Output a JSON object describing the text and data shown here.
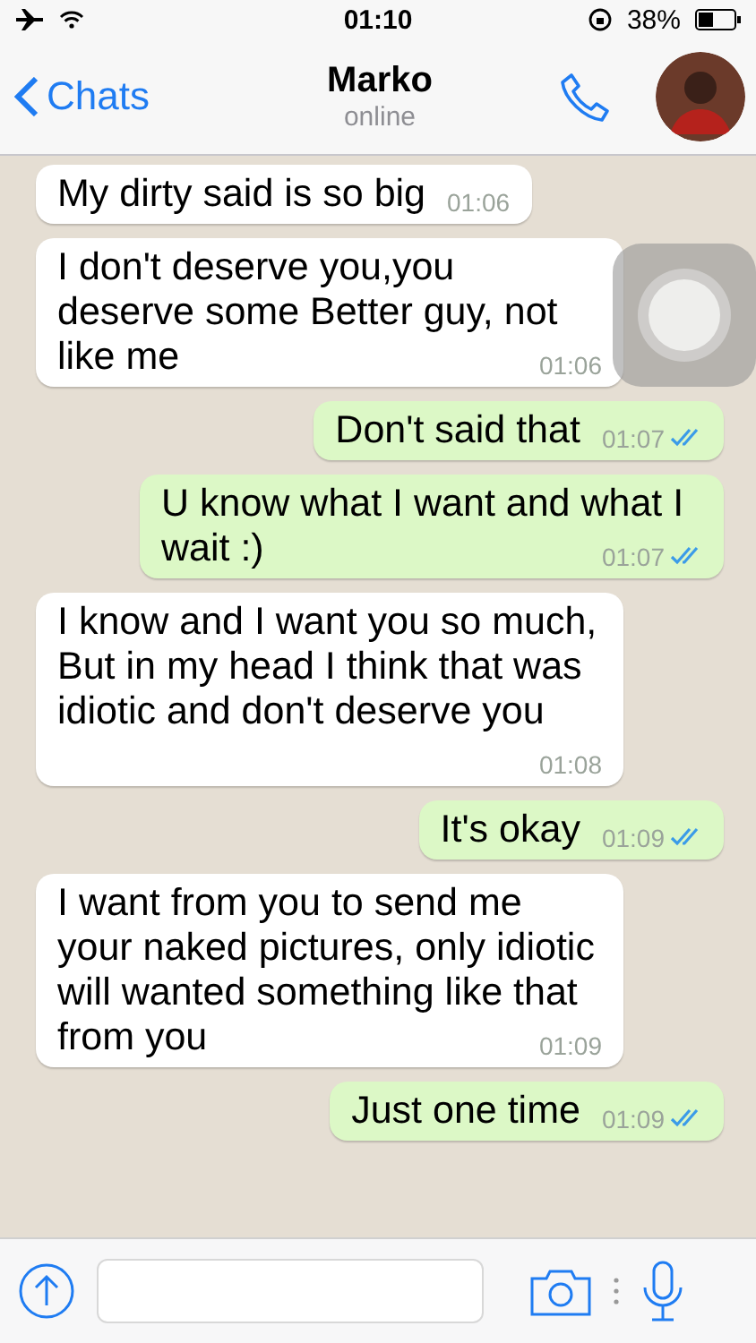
{
  "status_bar": {
    "time": "01:10",
    "battery": "38%"
  },
  "header": {
    "back": "Chats",
    "name": "Marko",
    "status": "online"
  },
  "messages": [
    {
      "kind": "incoming",
      "text": "My dirty said is so big",
      "time": "01:06"
    },
    {
      "kind": "incoming",
      "text": "I don't deserve you,you deserve some Better guy, not like me",
      "time": "01:06"
    },
    {
      "kind": "outgoing",
      "text": "Don't said that",
      "time": "01:07",
      "read": true
    },
    {
      "kind": "outgoing",
      "text": "U know what I want and what I wait :)",
      "time": "01:07",
      "read": true
    },
    {
      "kind": "incoming",
      "text": "I know and I want you so much, But in my head I think that was idiotic and don't deserve you",
      "time": "01:08"
    },
    {
      "kind": "outgoing",
      "text": "It's okay",
      "time": "01:09",
      "read": true
    },
    {
      "kind": "incoming",
      "text": "I want from you to send me your naked pictures, only idiotic will wanted something like that from you",
      "time": "01:09"
    },
    {
      "kind": "outgoing",
      "text": "Just one time",
      "time": "01:09",
      "read": true
    }
  ]
}
